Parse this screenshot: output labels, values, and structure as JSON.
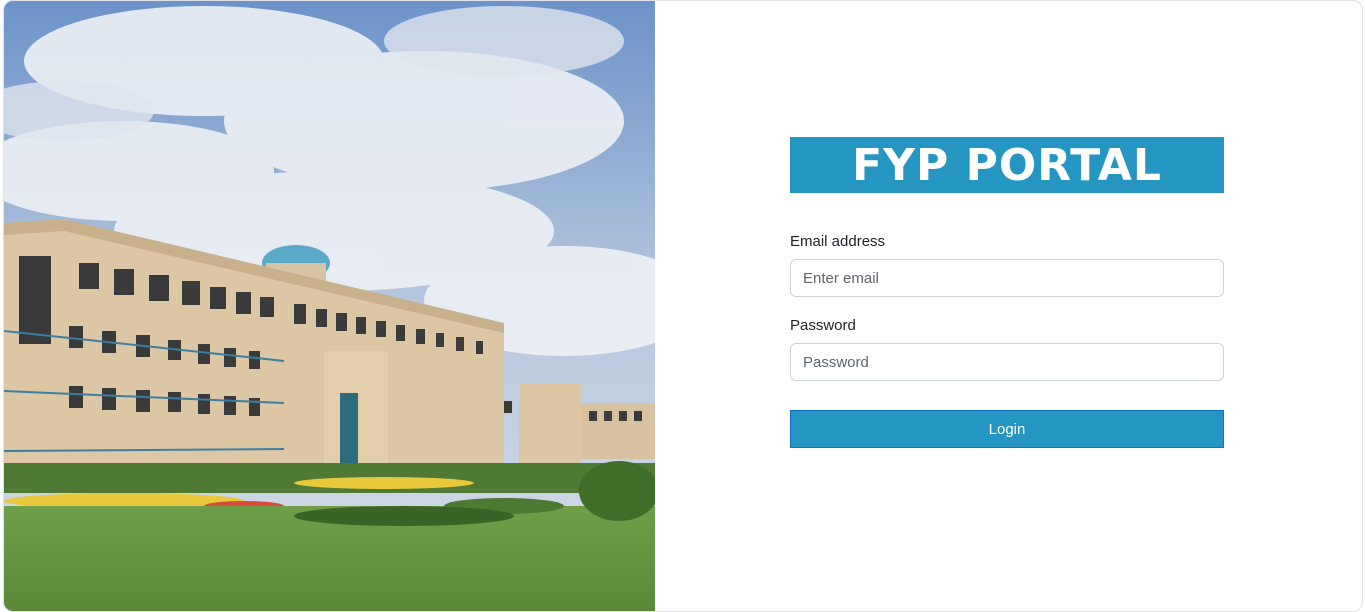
{
  "brand": {
    "title": "FYP PORTAL"
  },
  "form": {
    "email_label": "Email address",
    "email_placeholder": "Enter email",
    "email_value": "",
    "password_label": "Password",
    "password_placeholder": "Password",
    "password_value": "",
    "login_label": "Login"
  },
  "colors": {
    "accent": "#2596c2",
    "login_border": "#0f6fcf",
    "text": "#212529"
  }
}
